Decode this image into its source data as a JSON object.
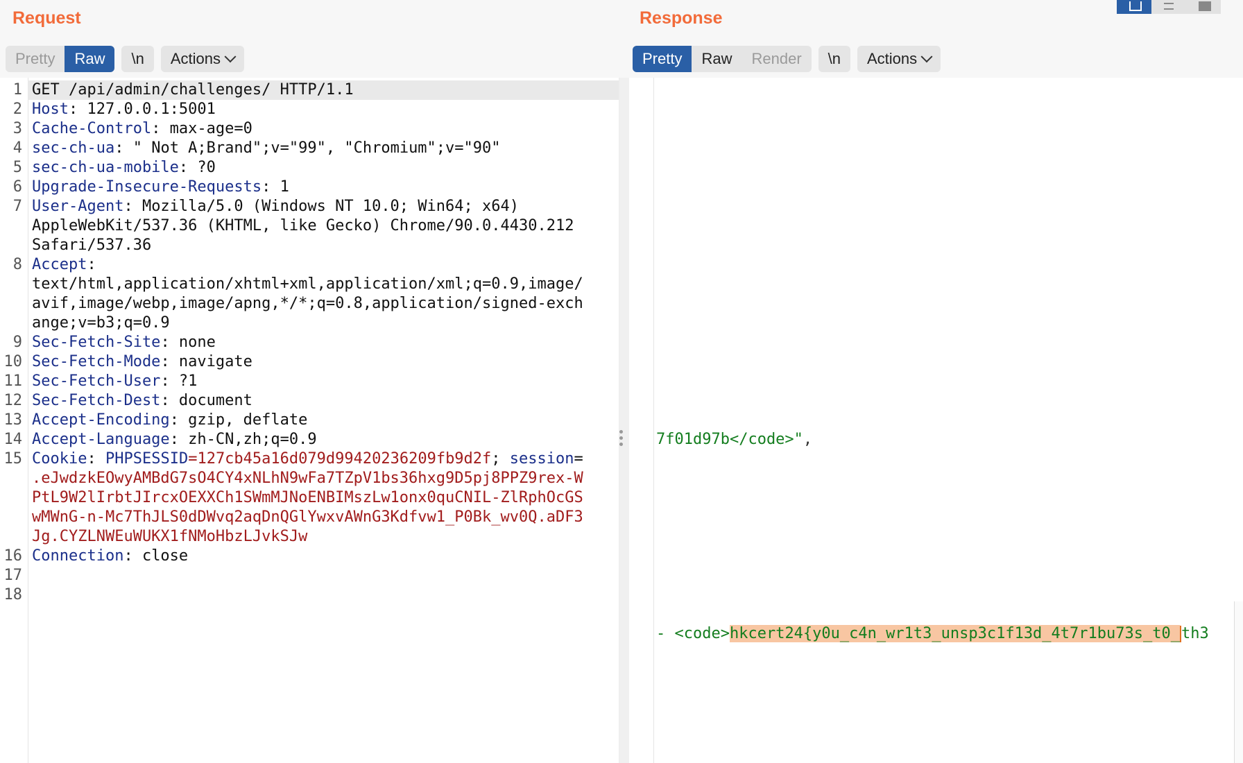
{
  "request": {
    "title": "Request",
    "tabs": [
      {
        "label": "Pretty",
        "state": "disabled"
      },
      {
        "label": "Raw",
        "state": "active"
      }
    ],
    "newline_label": "\\n",
    "actions_label": "Actions",
    "line_numbers": [
      "1",
      "2",
      "3",
      "4",
      "5",
      "6",
      "7",
      "",
      "",
      "8",
      "",
      "",
      "",
      "9",
      "10",
      "11",
      "12",
      "13",
      "14",
      "15",
      "",
      "",
      "",
      "",
      "16",
      "17",
      "18"
    ],
    "lines": [
      {
        "text": "GET /api/admin/challenges/ HTTP/1.1"
      },
      {
        "name": "Host",
        "value": ": 127.0.0.1:5001"
      },
      {
        "name": "Cache-Control",
        "value": ": max-age=0"
      },
      {
        "name": "sec-ch-ua",
        "value": ": \" Not A;Brand\";v=\"99\", \"Chromium\";v=\"90\""
      },
      {
        "name": "sec-ch-ua-mobile",
        "value": ": ?0"
      },
      {
        "name": "Upgrade-Insecure-Requests",
        "value": ": 1"
      },
      {
        "name": "User-Agent",
        "value": ": Mozilla/5.0 (Windows NT 10.0; Win64; x64)"
      },
      {
        "text": "AppleWebKit/537.36 (KHTML, like Gecko) Chrome/90.0.4430.212"
      },
      {
        "text": "Safari/537.36"
      },
      {
        "name": "Accept",
        "value": ":"
      },
      {
        "text": "text/html,application/xhtml+xml,application/xml;q=0.9,image/"
      },
      {
        "text": "avif,image/webp,image/apng,*/*;q=0.8,application/signed-exch"
      },
      {
        "text": "ange;v=b3;q=0.9"
      },
      {
        "name": "Sec-Fetch-Site",
        "value": ": none"
      },
      {
        "name": "Sec-Fetch-Mode",
        "value": ": navigate"
      },
      {
        "name": "Sec-Fetch-User",
        "value": ": ?1"
      },
      {
        "name": "Sec-Fetch-Dest",
        "value": ": document"
      },
      {
        "name": "Accept-Encoding",
        "value": ": gzip, deflate"
      },
      {
        "name": "Accept-Language",
        "value": ": zh-CN,zh;q=0.9"
      }
    ],
    "cookie": {
      "name": "Cookie",
      "sep": ": ",
      "phpsess_name": "PHPSESSID",
      "phpsess_value": "=127cb45a16d079d99420236209fb9d2f",
      "semi": "; ",
      "session_name": "session",
      "eq": "=",
      "session_lines": [
        ".eJwdzkEOwyAMBdG7sO4CY4xNLhN9wFa7TZpV1bs36hxg9D5pj8PPZ9rex-W",
        "PtL9W2lIrbtJIrcxOEXXCh1SWmMJNoENBIMszLw1onx0quCNIL-ZlRphOcGS",
        "wMWnG-n-Mc7ThJLS0dDWvq2aqDnQGlYwxvAWnG3Kdfvw1_P0Bk_wv0Q.aDF3",
        "Jg.CYZLNWEuWUKX1fNMoHbzLJvkSJw"
      ]
    },
    "after_lines": [
      {
        "name": "Connection",
        "value": ": close"
      }
    ]
  },
  "response": {
    "title": "Response",
    "tabs": [
      {
        "label": "Pretty",
        "state": "active"
      },
      {
        "label": "Raw",
        "state": "normal"
      },
      {
        "label": "Render",
        "state": "disabled"
      }
    ],
    "newline_label": "\\n",
    "actions_label": "Actions",
    "line_a_green": "7f01d97b</code>\"",
    "line_a_plain": ",",
    "line_b_prefix": "- <code>",
    "line_b_flag": "hkcert24{y0u_c4n_wr1t3_unsp3c1f13d_4t7r1bu73s_t0_",
    "line_b_tail": "th3"
  },
  "colors": {
    "accent": "#f26b3a",
    "active_tab": "#2a5fa6",
    "header_name": "#1b2f8a",
    "cookie_value": "#a11c1c",
    "json_string": "#137d1e",
    "flag_highlight": "#f8c6a2"
  },
  "icons": [
    "chevron-down-icon",
    "split-vertical-icon",
    "split-horizontal-icon",
    "single-pane-icon",
    "drag-handle-icon"
  ]
}
